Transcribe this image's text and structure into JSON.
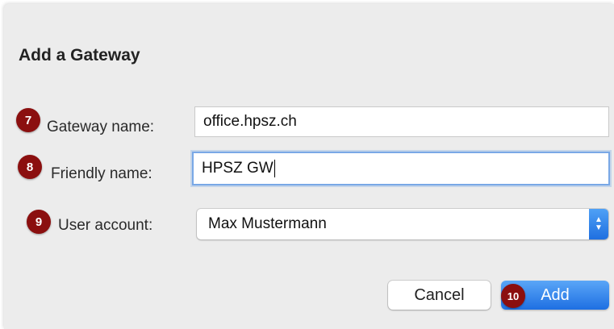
{
  "dialog": {
    "title": "Add a Gateway",
    "fields": {
      "gateway_name": {
        "marker": "7",
        "label": "Gateway name:",
        "value": "office.hpsz.ch"
      },
      "friendly_name": {
        "marker": "8",
        "label": "Friendly name:",
        "value": "HPSZ GW"
      },
      "user_account": {
        "marker": "9",
        "label": "User account:",
        "value": "Max Mustermann"
      }
    },
    "buttons": {
      "cancel_label": "Cancel",
      "add_label": "Add",
      "add_marker": "10"
    }
  },
  "colors": {
    "marker": "#8b0f0f",
    "accent": "#1e6fe2",
    "focus_ring": "#79a8e6"
  },
  "icons": {
    "stepper": "chevron-up-down-icon"
  }
}
